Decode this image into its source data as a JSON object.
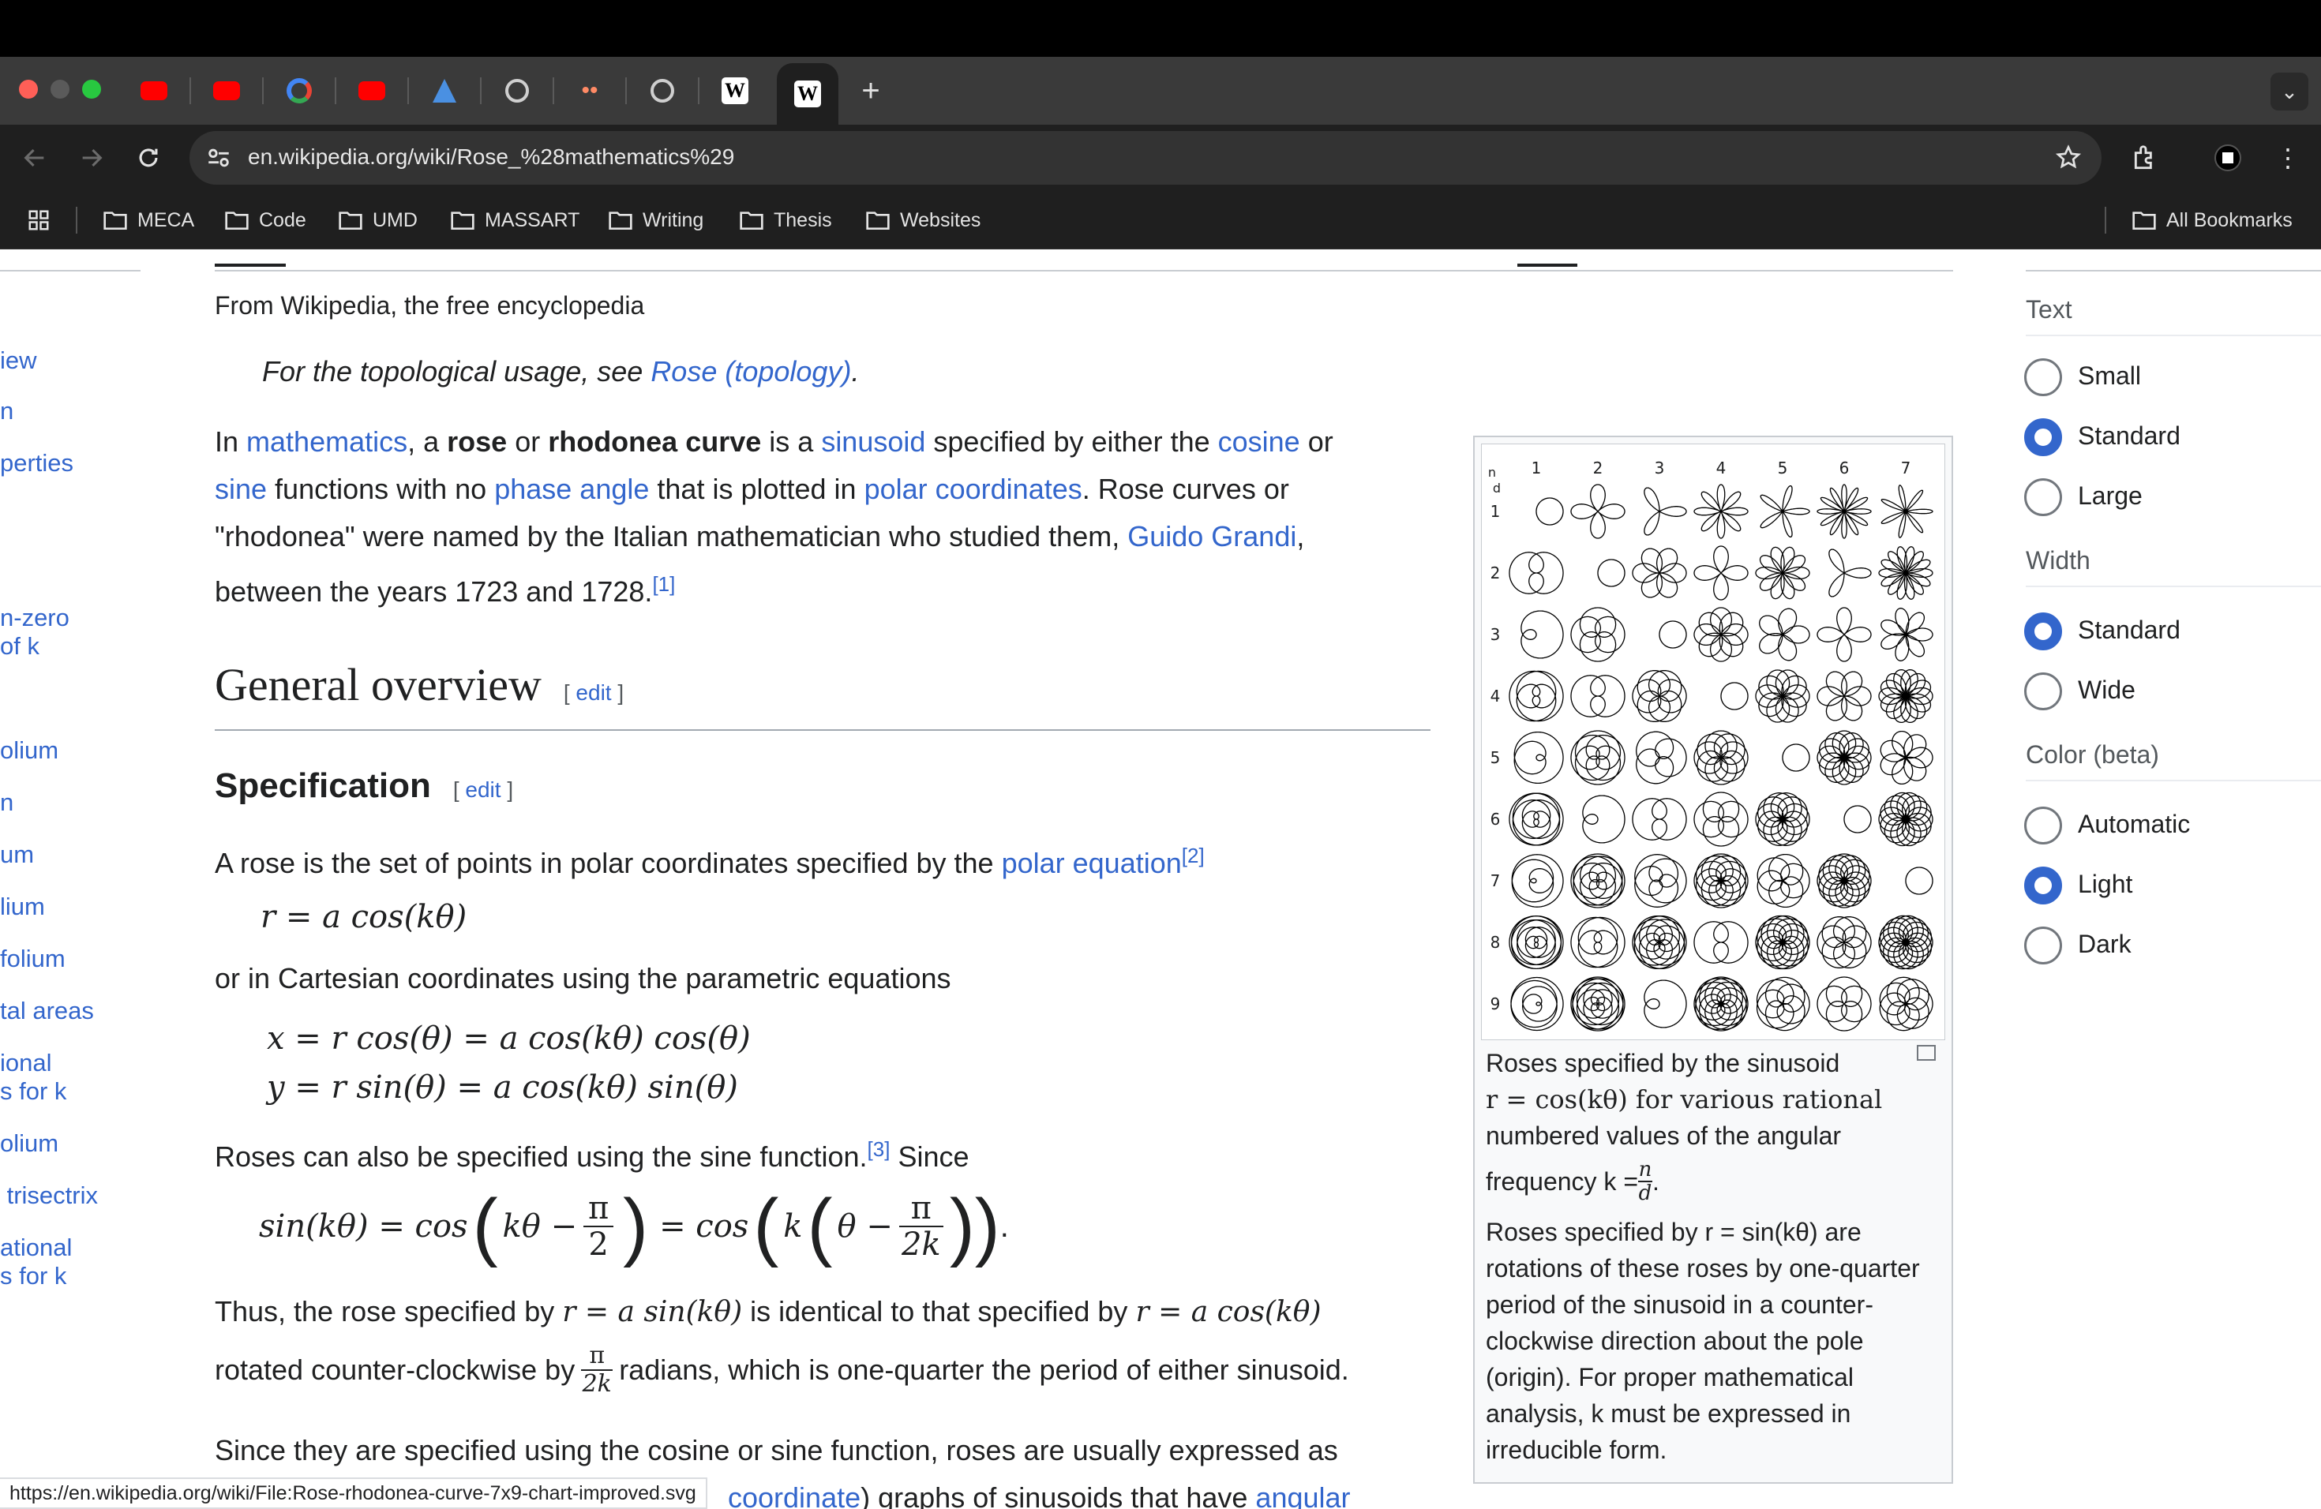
{
  "browser": {
    "tab_active_label": "W",
    "new_tab_label": "+",
    "url": "en.wikipedia.org/wiki/Rose_%28mathematics%29",
    "bookmarks": [
      "MECA",
      "Code",
      "UMD",
      "MASSART",
      "Writing",
      "Thesis",
      "Websites"
    ],
    "all_bookmarks": "All Bookmarks",
    "status_url": "https://en.wikipedia.org/wiki/File:Rose-rhodonea-curve-7x9-chart-improved.svg"
  },
  "sidebar": {
    "items": [
      "iew",
      "n",
      "perties",
      "n-zero",
      "of k",
      "olium",
      "n",
      "um",
      "lium",
      "folium",
      "tal areas",
      "ional",
      "s for k",
      "olium",
      " trisectrix",
      "ational",
      "s for k"
    ]
  },
  "article": {
    "tagline": "From Wikipedia, the free encyclopedia",
    "hatnote_prefix": "For the topological usage, see ",
    "hatnote_link": "Rose (topology)",
    "hatnote_suffix": ".",
    "intro": {
      "t1": "In ",
      "l1": "mathematics",
      "t2": ", a ",
      "b1": "rose",
      "t3": " or ",
      "b2": "rhodonea curve",
      "t4": " is a ",
      "l2": "sinusoid",
      "t5": " specified by either the ",
      "l3": "cosine",
      "t6": " or",
      "l4": "sine",
      "t7": " functions with no ",
      "l5": "phase angle",
      "t8": " that is plotted in ",
      "l6": "polar coordinates",
      "t9": ". Rose curves or",
      "line3_a": "\"rhodonea\" were named by the Italian mathematician who studied them, ",
      "l7": "Guido Grandi",
      "line3_b": ",",
      "line4": "between the years 1723 and 1728.",
      "ref1": "[1]"
    },
    "h2": "General overview",
    "edit": "edit",
    "h3": "Specification",
    "spec_text": "A rose is the set of points in polar coordinates specified by the ",
    "spec_link": "polar equation",
    "ref2": "[2]",
    "eq1": "r = a cos(kθ)",
    "cartesian_text": "or in Cartesian coordinates using the parametric equations",
    "eq2": "x = r cos(θ) = a cos(kθ) cos(θ)",
    "eq3": "y = r sin(θ) = a cos(kθ) sin(θ)",
    "sine_text_a": "Roses can also be specified using the sine function.",
    "ref3": "[3]",
    "sine_text_b": " Since",
    "eq4_left": "sin(kθ) = cos",
    "eq4_mid": "kθ −",
    "eq4_eq": "= cos",
    "eq4_k": "k",
    "eq4_theta": "θ −",
    "pi": "π",
    "two": "2",
    "twok": "2k",
    "thus_a": "Thus, the rose specified by ",
    "thus_eq1": "r = a sin(kθ)",
    "thus_b": " is identical to that specified by ",
    "thus_eq2": "r = a cos(kθ)",
    "rot_a": "rotated counter-clockwise by ",
    "rot_b": " radians, which is one-quarter the period of either sinusoid.",
    "since_text": "Since they are specified using the cosine or sine function, roses are usually expressed as",
    "last_link1": "coordinate",
    "last_mid": ") graphs of sinusoids that have ",
    "last_link2": "angular"
  },
  "figure": {
    "col_header": [
      "1",
      "2",
      "3",
      "4",
      "5",
      "6",
      "7"
    ],
    "row_header": [
      "1",
      "2",
      "3",
      "4",
      "5",
      "6",
      "7",
      "8",
      "9"
    ],
    "corner_n": "n",
    "corner_d": "d",
    "cap1": "Roses specified by the sinusoid",
    "cap2": "r = cos(kθ) for various rational",
    "cap3": "numbered values of the angular",
    "cap4_a": "frequency k = ",
    "cap4_n": "n",
    "cap4_d": "d",
    "cap5": "Roses specified by r = sin(kθ) are",
    "cap6": "rotations of these roses by one-quarter",
    "cap7": "period of the sinusoid in a counter-",
    "cap8": "clockwise direction about the pole",
    "cap9": "(origin). For proper mathematical",
    "cap10": "analysis, k must be expressed in",
    "cap11": "irreducible form."
  },
  "appearance": {
    "text_heading": "Text",
    "text_options": [
      "Small",
      "Standard",
      "Large"
    ],
    "text_selected": "Standard",
    "width_heading": "Width",
    "width_options": [
      "Standard",
      "Wide"
    ],
    "width_selected": "Standard",
    "color_heading": "Color (beta)",
    "color_options": [
      "Automatic",
      "Light",
      "Dark"
    ],
    "color_selected": "Light"
  }
}
